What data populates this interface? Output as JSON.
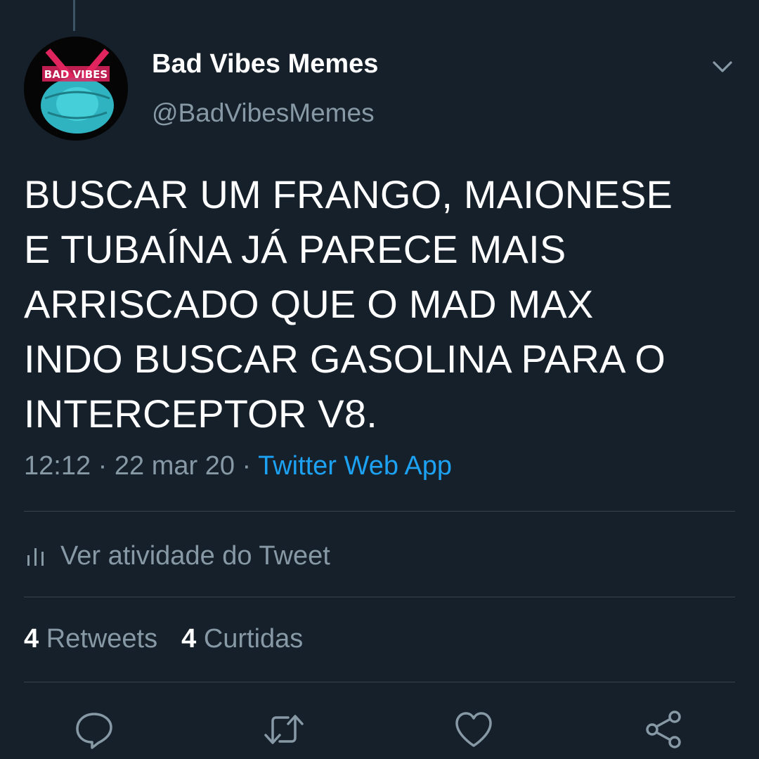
{
  "tweet": {
    "author": {
      "display_name": "Bad Vibes Memes",
      "handle": "@BadVibesMemes",
      "avatar_text": "BAD VIBES"
    },
    "text_lines": [
      "BUSCAR UM FRANGO, MAIONESE",
      "E TUBAÍNA JÁ PARECE MAIS",
      "ARRISCADO QUE O MAD MAX",
      "INDO BUSCAR GASOLINA PARA O",
      "INTERCEPTOR V8."
    ],
    "time": "12:12",
    "separator": "·",
    "date": "22 mar 20",
    "source": "Twitter Web App",
    "activity_label": "Ver atividade do Tweet",
    "stats": {
      "retweets_count": "4",
      "retweets_label": "Retweets",
      "likes_count": "4",
      "likes_label": "Curtidas"
    }
  },
  "icons": {
    "menu": "chevron-down-icon",
    "activity": "bar-chart-icon",
    "reply": "reply-icon",
    "retweet": "retweet-icon",
    "like": "heart-icon",
    "share": "share-icon"
  },
  "colors": {
    "background": "#15202b",
    "primary_text": "#ffffff",
    "secondary_text": "#8899a6",
    "link": "#1da1f2",
    "divider": "#38444d",
    "avatar_mask": "#2fb3c0",
    "avatar_accent": "#e0245e"
  }
}
